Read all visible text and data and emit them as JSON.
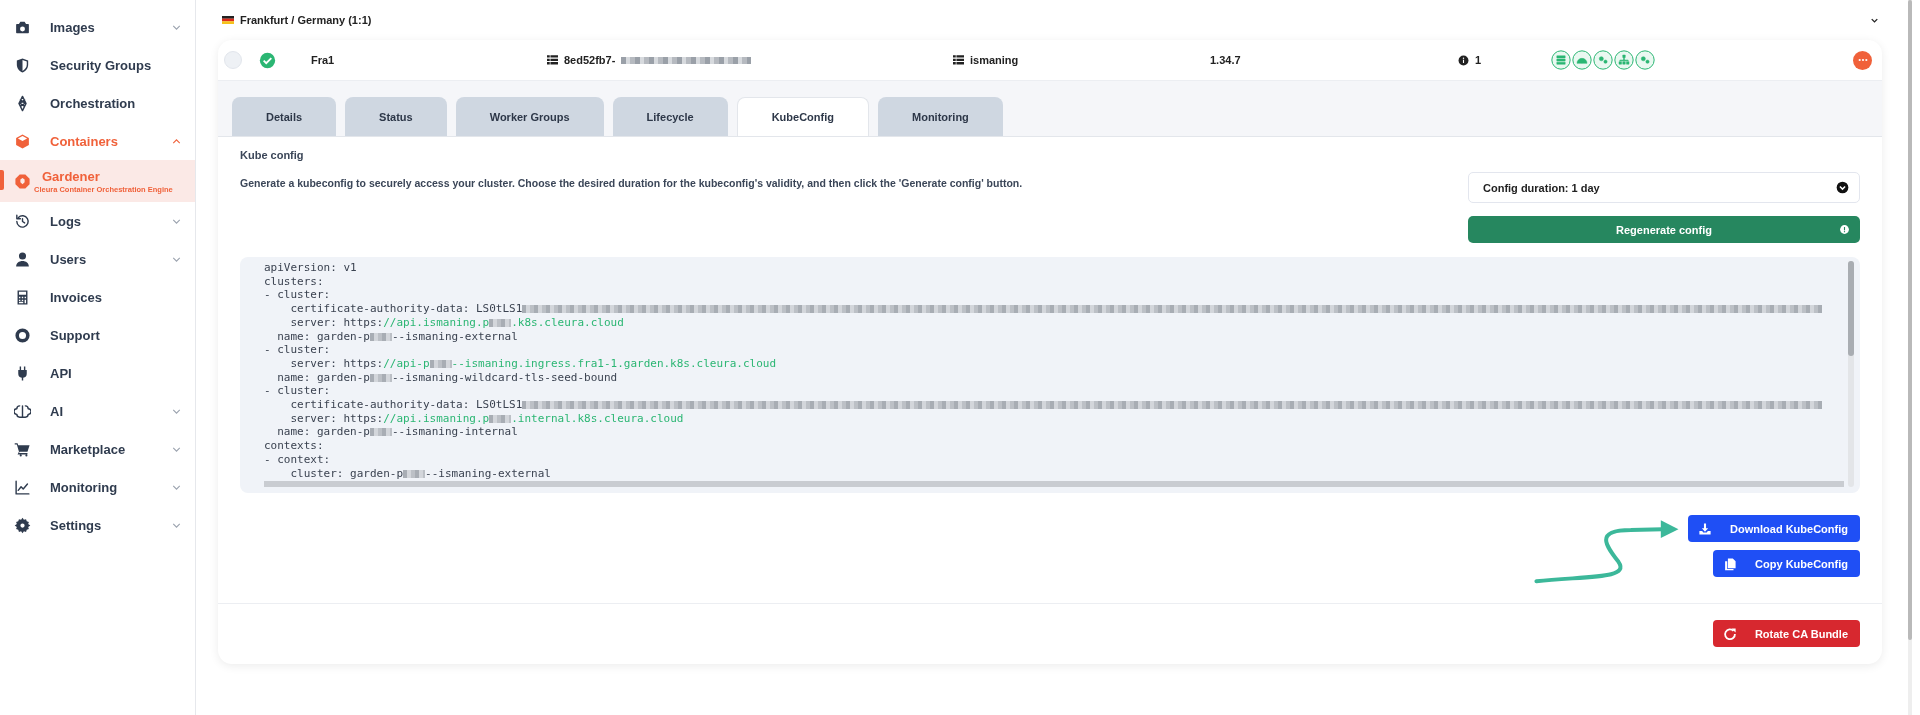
{
  "sidebar": {
    "items": [
      {
        "label": "Images",
        "expanded": false,
        "selected": false
      },
      {
        "label": "Security Groups",
        "selected": false
      },
      {
        "label": "Orchestration",
        "selected": false
      },
      {
        "label": "Containers",
        "expanded": true,
        "selected": false,
        "children": [
          {
            "label": "Gardener",
            "subtitle": "Cleura Container Orchestration Engine",
            "selected": true
          }
        ]
      },
      {
        "label": "Logs",
        "expanded": false,
        "selected": false
      },
      {
        "label": "Users",
        "expanded": false,
        "selected": false
      },
      {
        "label": "Invoices",
        "selected": false
      },
      {
        "label": "Support",
        "selected": false
      },
      {
        "label": "API",
        "selected": false
      },
      {
        "label": "AI",
        "expanded": false,
        "selected": false
      },
      {
        "label": "Marketplace",
        "expanded": false,
        "selected": false
      },
      {
        "label": "Monitoring",
        "expanded": false,
        "selected": false
      },
      {
        "label": "Settings",
        "expanded": false,
        "selected": false
      }
    ]
  },
  "region": {
    "label": "Frankfurt / Germany (1:1)"
  },
  "cluster": {
    "selected": false,
    "healthy": true,
    "name": "Fra1",
    "id": "8ed52fb7-",
    "project": "ismaning",
    "version": "1.34.7",
    "notices": "1"
  },
  "tabs": [
    {
      "label": "Details",
      "selected": false
    },
    {
      "label": "Status",
      "selected": false
    },
    {
      "label": "Worker Groups",
      "selected": false
    },
    {
      "label": "Lifecycle",
      "selected": false
    },
    {
      "label": "KubeConfig",
      "selected": true
    },
    {
      "label": "Monitoring",
      "selected": false
    }
  ],
  "kubeconfig": {
    "title": "Kube config",
    "description": "Generate a kubeconfig to securely access your cluster. Choose the desired duration for the kubeconfig's validity, and then click the 'Generate config' button.",
    "duration": "Config duration: 1 day",
    "regenerate_button": "Regenerate config",
    "code": [
      [
        {
          "kind": "text",
          "text": "apiVersion: v1"
        }
      ],
      [
        {
          "kind": "text",
          "text": "clusters:"
        }
      ],
      [
        {
          "kind": "text",
          "text": "- cluster:"
        }
      ],
      [
        {
          "kind": "text",
          "text": "    certificate-authority-data: LS0tLS1"
        },
        {
          "kind": "blur_long"
        }
      ],
      [
        {
          "kind": "text",
          "text": "    server: https:"
        },
        {
          "kind": "url",
          "text": "//api.ismaning.p"
        },
        {
          "kind": "blur"
        },
        {
          "kind": "url",
          "text": ".k8s.cleura.cloud"
        }
      ],
      [
        {
          "kind": "text",
          "text": "  name: garden-p"
        },
        {
          "kind": "blur"
        },
        {
          "kind": "text",
          "text": "--ismaning-external"
        }
      ],
      [
        {
          "kind": "text",
          "text": "- cluster:"
        }
      ],
      [
        {
          "kind": "text",
          "text": "    server: https:"
        },
        {
          "kind": "url",
          "text": "//api-p"
        },
        {
          "kind": "blur"
        },
        {
          "kind": "url",
          "text": "--ismaning.ingress.fra1-1.garden.k8s.cleura.cloud"
        }
      ],
      [
        {
          "kind": "text",
          "text": "  name: garden-p"
        },
        {
          "kind": "blur"
        },
        {
          "kind": "text",
          "text": "--ismaning-wildcard-tls-seed-bound"
        }
      ],
      [
        {
          "kind": "text",
          "text": "- cluster:"
        }
      ],
      [
        {
          "kind": "text",
          "text": "    certificate-authority-data: LS0tLS1"
        },
        {
          "kind": "blur_long"
        }
      ],
      [
        {
          "kind": "text",
          "text": "    server: https:"
        },
        {
          "kind": "url",
          "text": "//api.ismaning.p"
        },
        {
          "kind": "blur"
        },
        {
          "kind": "url",
          "text": ".internal.k8s.cleura.cloud"
        }
      ],
      [
        {
          "kind": "text",
          "text": "  name: garden-p"
        },
        {
          "kind": "blur"
        },
        {
          "kind": "text",
          "text": "--ismaning-internal"
        }
      ],
      [
        {
          "kind": "text",
          "text": "contexts:"
        }
      ],
      [
        {
          "kind": "text",
          "text": "- context:"
        }
      ],
      [
        {
          "kind": "text",
          "text": "    cluster: garden-p"
        },
        {
          "kind": "blur"
        },
        {
          "kind": "text",
          "text": "--ismaning-external"
        }
      ]
    ],
    "download_button": "Download KubeConfig",
    "copy_button": "Copy KubeConfig"
  },
  "rotate_button": "Rotate CA Bundle"
}
